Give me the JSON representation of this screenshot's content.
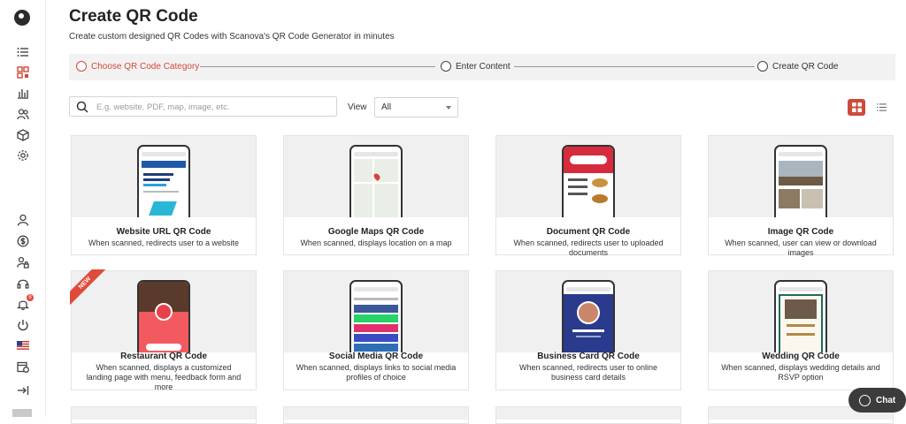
{
  "page": {
    "title": "Create QR Code",
    "subtitle": "Create custom designed QR Codes with Scanova's QR Code Generator in minutes"
  },
  "stepper": {
    "steps": [
      {
        "label": "Choose QR Code Category",
        "active": true
      },
      {
        "label": "Enter Content",
        "active": false
      },
      {
        "label": "Create QR Code",
        "active": false
      }
    ]
  },
  "filters": {
    "search_placeholder": "E.g. website, PDF, map, image, etc.",
    "view_label": "View",
    "view_selected": "All"
  },
  "cards": [
    {
      "title": "Website URL QR Code",
      "description": "When scanned, redirects user to a website"
    },
    {
      "title": "Google Maps QR Code",
      "description": "When scanned, displays location on a map"
    },
    {
      "title": "Document QR Code",
      "description": "When scanned, redirects user to uploaded documents"
    },
    {
      "title": "Image QR Code",
      "description": "When scanned, user can view or download images"
    },
    {
      "title": "Restaurant QR Code",
      "description": "When scanned, displays a customized landing page with menu, feedback form and more",
      "ribbon": "NEW"
    },
    {
      "title": "Social Media QR Code",
      "description": "When scanned, displays links to social media profiles of choice"
    },
    {
      "title": "Business Card QR Code",
      "description": "When scanned, redirects user to online business card details"
    },
    {
      "title": "Wedding QR Code",
      "description": "When scanned, displays wedding details and RSVP option"
    }
  ],
  "sidebar": {
    "notification_count": "8",
    "active_color": "#d4483a"
  },
  "chat": {
    "label": "Chat"
  },
  "colors": {
    "accent": "#cf4a3b",
    "stepper_bg": "#f2f2f2"
  }
}
